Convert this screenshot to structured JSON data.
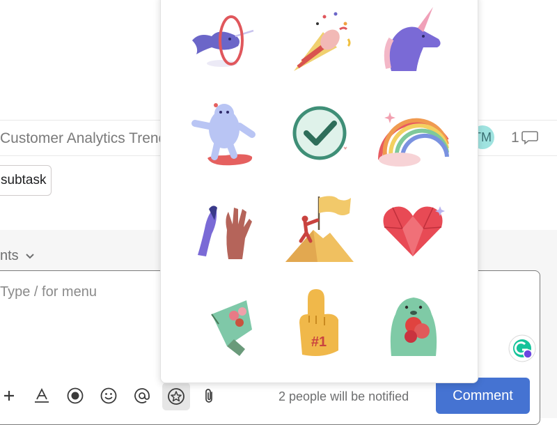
{
  "task": {
    "name": "Customer Analytics Trends",
    "assignee_initials": "TM",
    "comment_count": "1"
  },
  "subtask_button": {
    "label": "subtask"
  },
  "comments_section": {
    "tab_label": "nts"
  },
  "editor": {
    "placeholder": "Type / for menu",
    "notify_text": "2 people will be notified",
    "submit_label": "Comment"
  },
  "toolbar": {
    "icons": [
      "plus-icon",
      "text-format-icon",
      "record-icon",
      "emoji-icon",
      "mention-icon",
      "sticker-icon",
      "attachment-icon"
    ]
  },
  "sticker_picker": {
    "stickers": [
      "narwhal-hoop",
      "party-popper",
      "unicorn",
      "yeti-snowboard",
      "checkmark",
      "rainbow",
      "high-five",
      "summit-flag",
      "gem-heart",
      "flower-bouquet",
      "foam-finger",
      "otter-heart"
    ]
  },
  "colors": {
    "accent": "#4573d2",
    "comments_background": "#f6f6f6",
    "avatar": "#9fe3e0"
  }
}
